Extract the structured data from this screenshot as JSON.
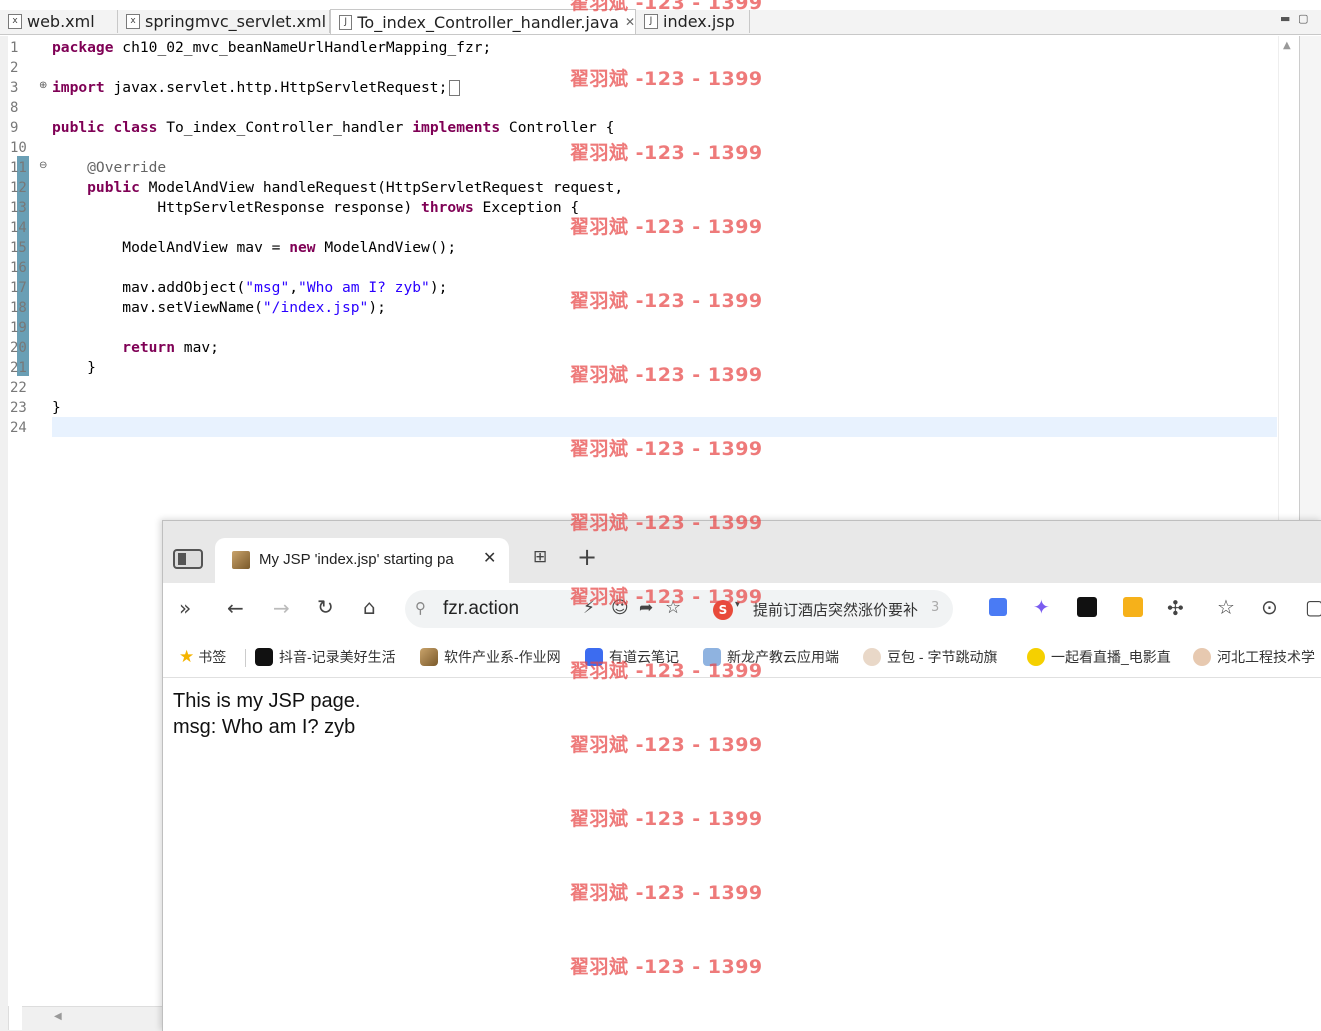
{
  "editor": {
    "tabs": [
      {
        "label": "web.xml",
        "icon": "xml-file-icon"
      },
      {
        "label": "springmvc_servlet.xml",
        "icon": "xml-file-icon"
      },
      {
        "label": "To_index_Controller_handler.java",
        "icon": "java-file-icon",
        "active": true
      },
      {
        "label": "index.jsp",
        "icon": "jsp-file-icon"
      }
    ],
    "line_numbers": [
      "1",
      "2",
      "3",
      "8",
      "9",
      "10",
      "11",
      "12",
      "13",
      "14",
      "15",
      "16",
      "17",
      "18",
      "19",
      "20",
      "21",
      "22",
      "23",
      "24"
    ],
    "code": {
      "l1_kw": "package",
      "l1_rest": " ch10_02_mvc_beanNameUrlHandlerMapping_fzr;",
      "l3_kw": "import",
      "l3_rest": " javax.servlet.http.HttpServletRequest;",
      "l9_kw1": "public",
      "l9_kw2": "class",
      "l9_mid": " To_index_Controller_handler ",
      "l9_kw3": "implements",
      "l9_rest": " Controller {",
      "l11_ann": "    @Override",
      "l12_kw": "    public",
      "l12_rest": " ModelAndView handleRequest(HttpServletRequest request,",
      "l13_pre": "            HttpServletResponse response) ",
      "l13_kw": "throws",
      "l13_rest": " Exception {",
      "l15_pre": "        ModelAndView mav = ",
      "l15_kw": "new",
      "l15_rest": " ModelAndView();",
      "l17_pre": "        mav.addObject(",
      "l17_s1": "\"msg\"",
      "l17_mid": ",",
      "l17_s2": "\"Who am I? zyb\"",
      "l17_rest": ");",
      "l18_pre": "        mav.setViewName(",
      "l18_s1": "\"/index.jsp\"",
      "l18_rest": ");",
      "l20_kw": "        return",
      "l20_rest": " mav;",
      "l21": "    }",
      "l23": "}"
    }
  },
  "browser": {
    "tab_title": "My JSP 'index.jsp' starting pa",
    "address": "fzr.action",
    "news_ticker": "提前订酒店突然涨价要补",
    "news_count": "3",
    "bookmarks": [
      {
        "label": "书签",
        "icon": "star-icon"
      },
      {
        "label": "抖音-记录美好生活",
        "icon": "douyin-icon"
      },
      {
        "label": "软件产业系-作业网",
        "icon": "page-icon"
      },
      {
        "label": "有道云笔记",
        "icon": "youdao-icon"
      },
      {
        "label": "新龙产教云应用端",
        "icon": "cloud-icon"
      },
      {
        "label": "豆包 - 字节跳动旗",
        "icon": "doubao-icon"
      },
      {
        "label": "一起看直播_电影直",
        "icon": "live-icon"
      },
      {
        "label": "河北工程技术学",
        "icon": "school-icon"
      }
    ],
    "page": {
      "line1": "This is my JSP page.",
      "line2": "msg: Who am I? zyb"
    }
  },
  "watermark": "翟羽斌 -123 - 1399"
}
